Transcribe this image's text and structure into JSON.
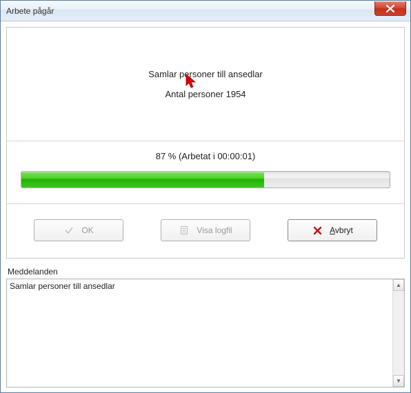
{
  "window": {
    "title": "Arbete pågår"
  },
  "status": {
    "line1": "Samlar personer till ansedlar",
    "line2": "Antal personer 1954"
  },
  "progress": {
    "label": "87 % (Arbetat i 00:00:01)",
    "percent": 66
  },
  "buttons": {
    "ok": "OK",
    "viewlog": "Visa logfil",
    "cancel": "Avbryt"
  },
  "messages": {
    "label": "Meddelanden",
    "content": "Samlar personer till ansedlar"
  }
}
